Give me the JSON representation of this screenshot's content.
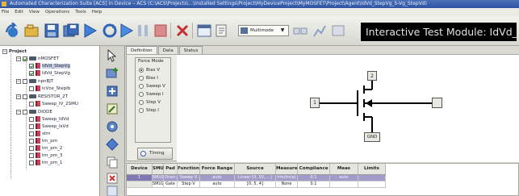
{
  "window": {
    "title": "Automated Characterization Suite [ACS] in Device – ACS (C:\\ACS\\Projects\\...\\Installed Settings\\Project\\MyDeviceProject\\MyMOSFET\\Project\\Agent\\IdVd_StepVg_5-Vg_StepVd)"
  },
  "menu": {
    "items": [
      "File",
      "Edit",
      "View",
      "Operations",
      "Tools",
      "Help"
    ]
  },
  "toolbar": {
    "mode_value": "Multimode",
    "module_title": "Interactive Test Module: IdVd_S"
  },
  "tree": {
    "root_label": "Project",
    "items": [
      {
        "label": "nMOSFET",
        "level": 1,
        "kind": "device",
        "checked": true
      },
      {
        "label": "IdVd_StepVg",
        "level": 2,
        "kind": "test",
        "checked": true,
        "selected": true
      },
      {
        "label": "IdVd_StepVg",
        "level": 2,
        "kind": "test",
        "checked": true
      },
      {
        "label": "npnBJT",
        "level": 1,
        "kind": "device",
        "checked": false
      },
      {
        "label": "IcVce_StepIb",
        "level": 2,
        "kind": "test",
        "checked": false
      },
      {
        "label": "RESISTOR_2T",
        "level": 1,
        "kind": "device",
        "checked": false
      },
      {
        "label": "Sweep_IV_2SMU",
        "level": 2,
        "kind": "test",
        "checked": false
      },
      {
        "label": "DIODE",
        "level": 1,
        "kind": "device",
        "checked": false
      },
      {
        "label": "Sweep_IdVd",
        "level": 2,
        "kind": "test",
        "checked": false
      },
      {
        "label": "Sweep_IsVd",
        "level": 2,
        "kind": "test",
        "checked": false
      },
      {
        "label": "stm",
        "level": 2,
        "kind": "test",
        "checked": false
      },
      {
        "label": "tm_pm",
        "level": 2,
        "kind": "test",
        "checked": false
      },
      {
        "label": "tm_pm_2",
        "level": 2,
        "kind": "test",
        "checked": false
      },
      {
        "label": "tm_pm_3",
        "level": 2,
        "kind": "test",
        "checked": false
      },
      {
        "label": "tm_pm_1",
        "level": 2,
        "kind": "test",
        "checked": false
      }
    ]
  },
  "tabs": [
    "Definition",
    "Data",
    "Status"
  ],
  "force_mode": {
    "title": "Force Mode",
    "options": [
      "Bias V",
      "Bias I",
      "Sweep V",
      "Sweep I",
      "Step V",
      "Step I"
    ],
    "selected_index": 0
  },
  "timing_label": "Timing",
  "schematic": {
    "terminals": {
      "top": "2",
      "left": "1",
      "right": "",
      "bottom": "GND"
    }
  },
  "grid": {
    "headers": [
      "Device Num",
      "SMU",
      "Pad",
      "Function",
      "Force Range",
      "Source",
      "Measure",
      "Compliance",
      "Meas Range",
      "Limits Auto"
    ],
    "rows": [
      [
        "1",
        "SMU1",
        "Drain",
        "Sweep V",
        "auto",
        "Linear [0, 5V, ...]",
        "Vm/Im(a)",
        "0.1",
        "auto",
        ""
      ],
      [
        "",
        "SMU2",
        "Gate",
        "Step V",
        "auto",
        "[0, 5, 4]",
        "None",
        "0.1",
        "",
        ""
      ]
    ]
  },
  "colors": {
    "title_bar": "#2d54a3",
    "selected_row": "#a29ccb",
    "module_bar": "#000000"
  }
}
